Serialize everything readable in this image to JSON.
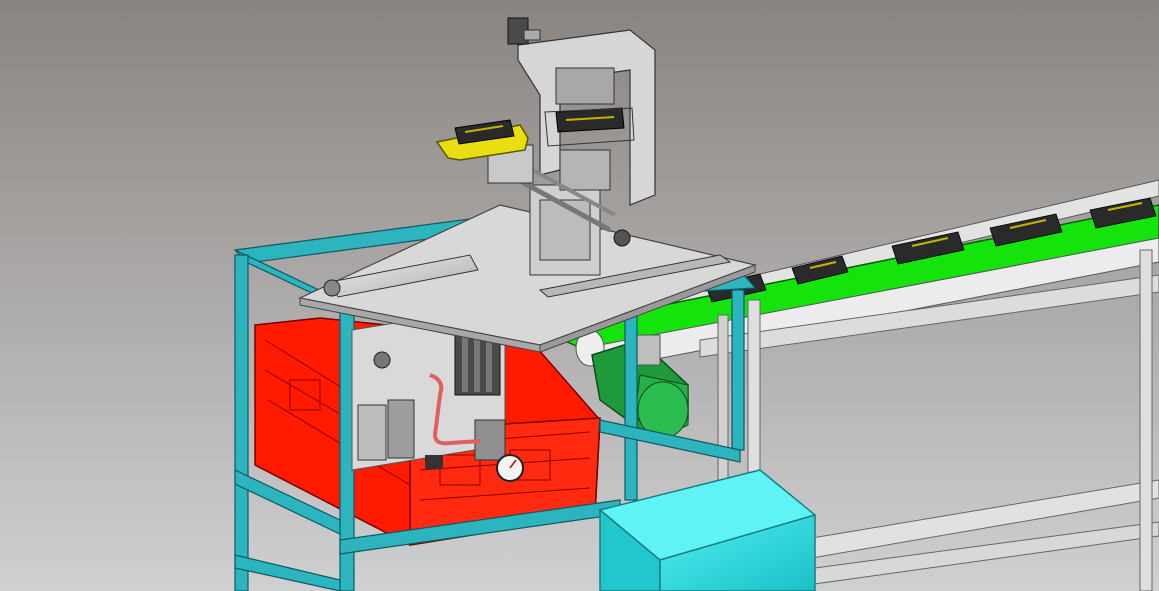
{
  "scene": {
    "colors": {
      "background_top": "#8a8480",
      "background_bottom": "#cfd0d2",
      "frame": "#2cb5bf",
      "crate": "#ff1a00",
      "belt": "#14e40c",
      "motor": "#1f9a3b",
      "gripper": "#e8de12",
      "plate": "#d8d8d8",
      "cabinet": "#2de0e6"
    }
  }
}
